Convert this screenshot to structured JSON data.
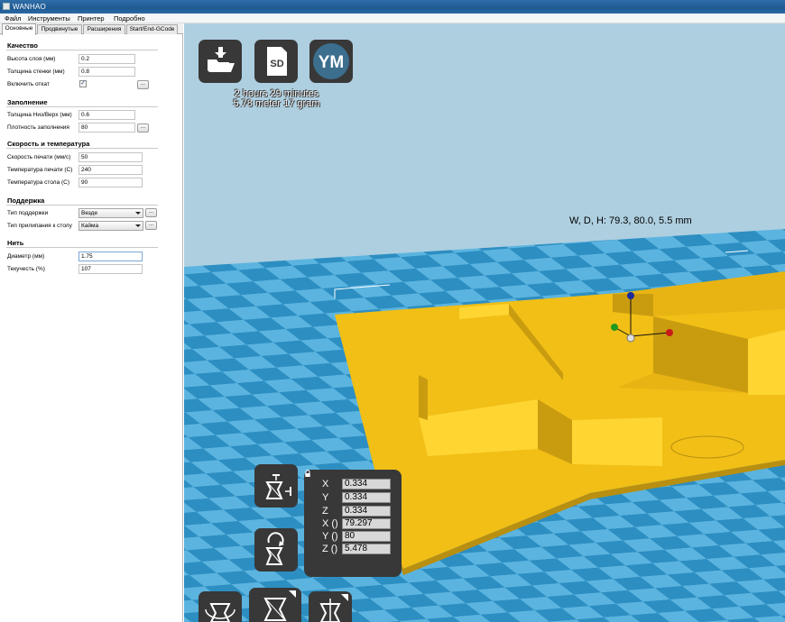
{
  "window": {
    "title": "WANHAO"
  },
  "menu": [
    "Файл",
    "Инструменты",
    "Принтер",
    "Подробно"
  ],
  "tabs": [
    "Основные",
    "Продвинутые",
    "Расширения",
    "Start/End-GCode"
  ],
  "sections": {
    "quality": {
      "title": "Качество",
      "layer_height_label": "Высота слоя (мм)",
      "layer_height": "0.2",
      "wall_label": "Толщина стенки (мм)",
      "wall": "0.8",
      "retract_label": "Включить откат",
      "retract_checked": true
    },
    "fill": {
      "title": "Заполнение",
      "bottom_top_label": "Толщина Низ/Верх (мм)",
      "bottom_top": "0.6",
      "density_label": "Плотность заполнения",
      "density": "80"
    },
    "speed": {
      "title": "Скорость и температура",
      "print_speed_label": "Скорость печати (мм/с)",
      "print_speed": "50",
      "print_temp_label": "Температура печати (С)",
      "print_temp": "240",
      "bed_temp_label": "Температура стола (С)",
      "bed_temp": "90"
    },
    "support": {
      "title": "Поддержка",
      "type_label": "Тип поддержки",
      "type_value": "Везде",
      "adhesion_label": "Тип прилипания к столу",
      "adhesion_value": "Кайма"
    },
    "filament": {
      "title": "Нить",
      "diameter_label": "Диаметр (мм)",
      "diameter": "1.75",
      "flow_label": "Текучесть (%)",
      "flow": "107"
    }
  },
  "dots_label": "...",
  "check_glyph": "✓",
  "viewport": {
    "sd_label": "SD",
    "ym_label": "YM",
    "print_time": "2 hours 29 minutes",
    "print_material": "5.78 meter 17 gram",
    "dimensions": "W, D, H: 79.3, 80.0, 5.5 mm",
    "axis_labels": [
      "X",
      "Y",
      "Z",
      "X ()",
      "Y ()",
      "Z ()"
    ],
    "scale": {
      "x": "0.334",
      "y": "0.334",
      "z": "0.334"
    },
    "size": {
      "x": "79.297",
      "y": "80",
      "z": "5.478"
    }
  },
  "colors": {
    "sky": "#aecfe0",
    "tile_light": "#54b0dc",
    "tile_dark": "#2d8ec2",
    "model": "#f2c218",
    "model_side": "#c29c14",
    "panel": "#383838"
  }
}
